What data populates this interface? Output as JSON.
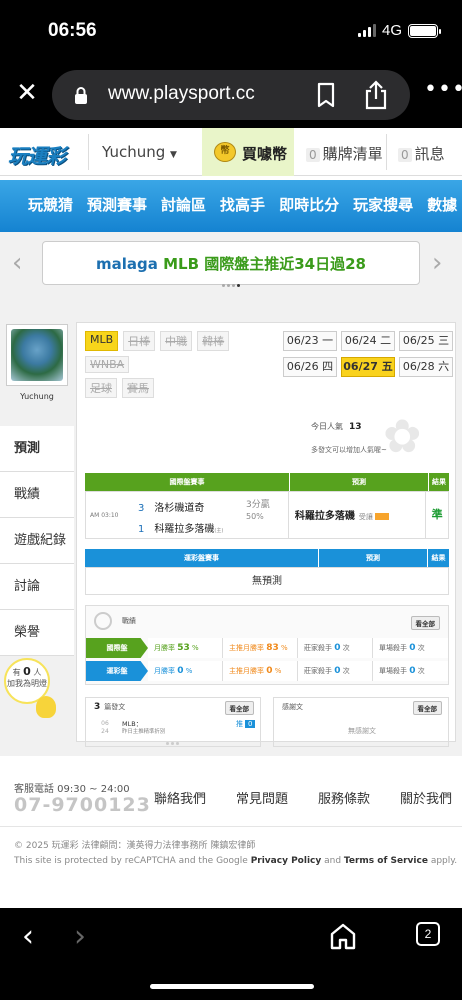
{
  "status_bar": {
    "time": "06:56",
    "network": "4G"
  },
  "browser": {
    "url": "www.playsport.cc"
  },
  "header": {
    "logo": "玩運彩",
    "username": "Yuchung",
    "coins_label": "買噱幣",
    "cart_count": "0",
    "cart_label": "購牌清單",
    "msg_count": "0",
    "msg_label": "訊息"
  },
  "nav": {
    "items": [
      "玩競猜",
      "預測賽事",
      "討論區",
      "找高手",
      "即時比分",
      "玩家搜尋",
      "數據"
    ]
  },
  "ticker": {
    "user": "malaga",
    "text": "MLB 國際盤主推近34日過28"
  },
  "side": {
    "username": "Yuchung",
    "menu": [
      "預測",
      "戰績",
      "遊戲紀錄",
      "討論",
      "榮譽"
    ],
    "fans_prefix": "有",
    "fans_count": "0",
    "fans_suffix": "人",
    "fans_note": "加我為明燈"
  },
  "leagues": {
    "row1": [
      "MLB",
      "日棒",
      "中職",
      "韓棒"
    ],
    "row2": [
      "WNBA"
    ],
    "row3": [
      "足球",
      "賽馬"
    ]
  },
  "dates": [
    "06/23 一",
    "06/24 二",
    "06/25 三",
    "06/26 四",
    "06/27 五",
    "06/28 六"
  ],
  "popularity": {
    "label": "今日人氣",
    "value": "13",
    "note": "多發文可以增加人氣喔~"
  },
  "intl_table": {
    "headers": [
      "國際盤賽事",
      "預測",
      "結果"
    ],
    "game": {
      "time": "AM 03:10",
      "team1_num": "3",
      "team1": "洛杉磯道奇",
      "team2_num": "1",
      "team2": "科羅拉多落磯",
      "team2_tag": "(主)",
      "line1": "3分贏",
      "line2": "50%",
      "prediction": "科羅拉多落磯",
      "prediction_tag": "受讓",
      "result": "準"
    }
  },
  "lottery_table": {
    "headers": [
      "運彩盤賽事",
      "預測",
      "結果"
    ],
    "empty": "無預測"
  },
  "stats": {
    "title": "戰績",
    "view_all": "看全部",
    "rows": [
      {
        "label": "國際盤",
        "c1": "月勝率",
        "v1": "53",
        "u1": "%",
        "c2": "主推月勝率",
        "v2": "83",
        "u2": "%",
        "c3": "莊家殺手",
        "v3": "0",
        "u3": "次",
        "c4": "單場殺手",
        "v4": "0",
        "u4": "次"
      },
      {
        "label": "運彩盤",
        "c1": "月勝率",
        "v1": "0",
        "u1": "%",
        "c2": "主推月勝率",
        "v2": "0",
        "u2": "%",
        "c3": "莊家殺手",
        "v3": "0",
        "u3": "次",
        "c4": "單場殺手",
        "v4": "0",
        "u4": "次"
      }
    ],
    "colors": {
      "intl": "#57a21e",
      "lottery": "#1a91d9"
    }
  },
  "posts": {
    "count": "3",
    "label": "篇發文",
    "view_all": "看全部",
    "item": {
      "date_month": "06",
      "date_day": "24",
      "title": "MLB：",
      "subtitle": "昨日主推精準折別",
      "tag": "推",
      "tag_count": "0"
    }
  },
  "replies": {
    "label": "感謝文",
    "view_all": "看全部",
    "empty": "無感謝文"
  },
  "footer": {
    "hotline_label": "客服電話 09:30 ~ 24:00",
    "phone": "07-9700123",
    "links": [
      "聯絡我們",
      "常見問題",
      "服務條款",
      "關於我們"
    ],
    "copyright": "© 2025 玩運彩 法律顧問：漢英得力法律事務所 陳鎮宏律師",
    "recaptcha_pre": "This site is protected by reCAPTCHA and the Google",
    "privacy": "Privacy Policy",
    "and": "and",
    "terms": "Terms of Service",
    "apply": "apply."
  },
  "bottom": {
    "tabs_count": "2"
  }
}
